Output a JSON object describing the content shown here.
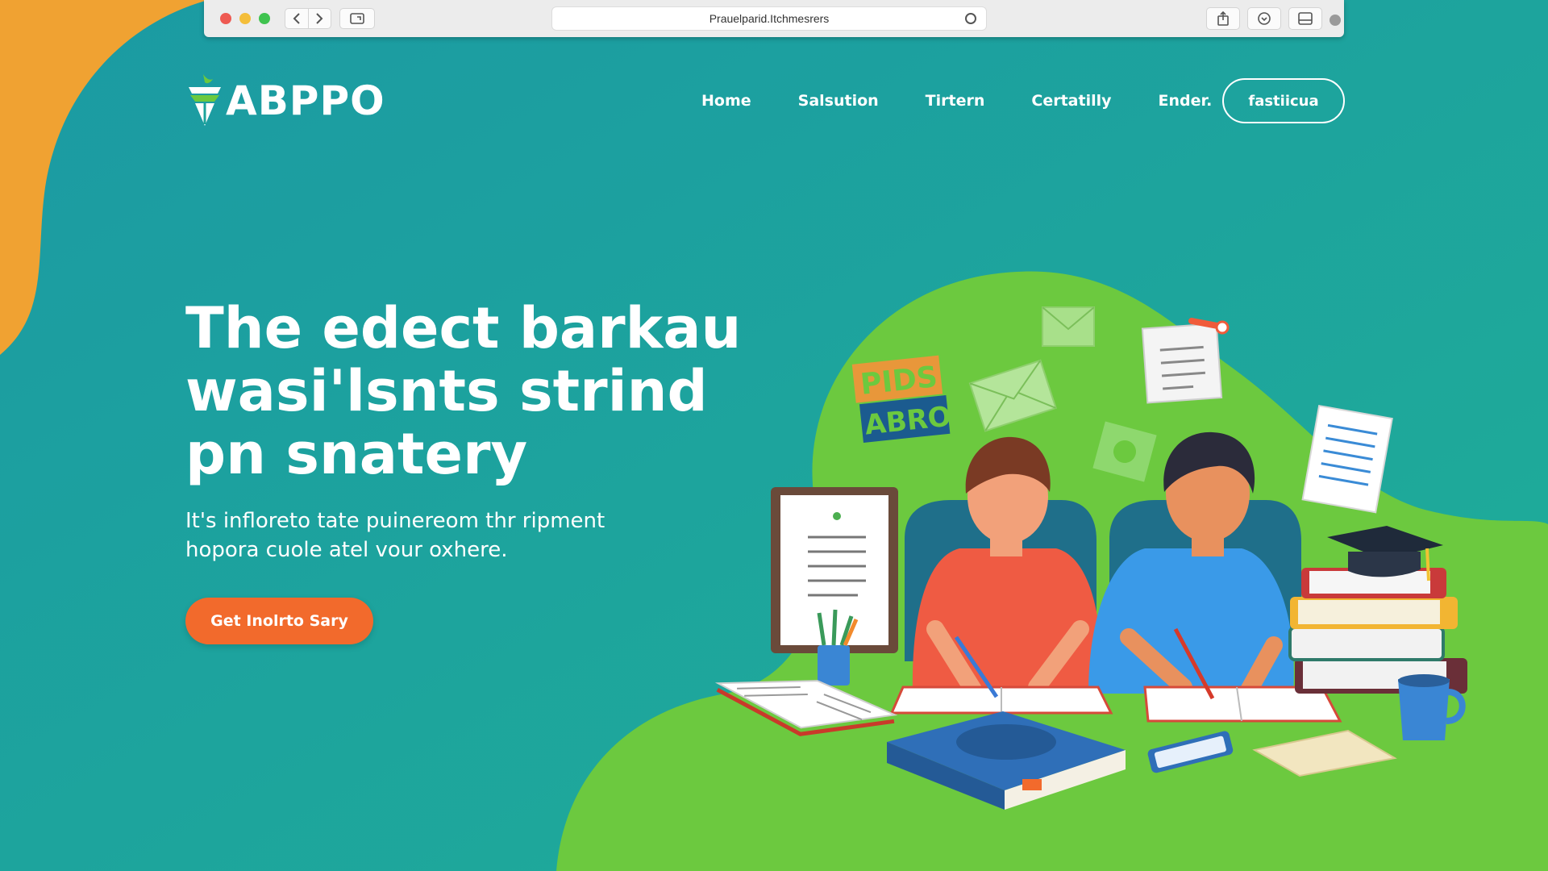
{
  "browser": {
    "url": "Prauelparid.Itchmesrers",
    "colors": {
      "close": "#ee5a52",
      "minimize": "#f4be3a",
      "maximize": "#3fc34f"
    }
  },
  "header": {
    "logo_text": "ABPPO",
    "nav": [
      "Home",
      "Salsution",
      "Tirtern",
      "Certatilly",
      "Ender."
    ],
    "cta_label": "fastiicua"
  },
  "hero": {
    "title_lines": [
      "The edect barkau",
      "wasi'lsnts strind",
      "pn snatery"
    ],
    "subtitle_lines": [
      "It's infloreto tate puinereom thr ripment",
      "hopora cuole atel vour oxhere."
    ],
    "cta_label": "Get Inolrto Sary"
  },
  "illustration": {
    "sign_text_top": "PIDS",
    "sign_text_bottom": "ABRO"
  },
  "colors": {
    "teal": "#1ca39a",
    "green": "#6cc93f",
    "orange_blob": "#f0a232",
    "cta_orange": "#f26a2c"
  }
}
